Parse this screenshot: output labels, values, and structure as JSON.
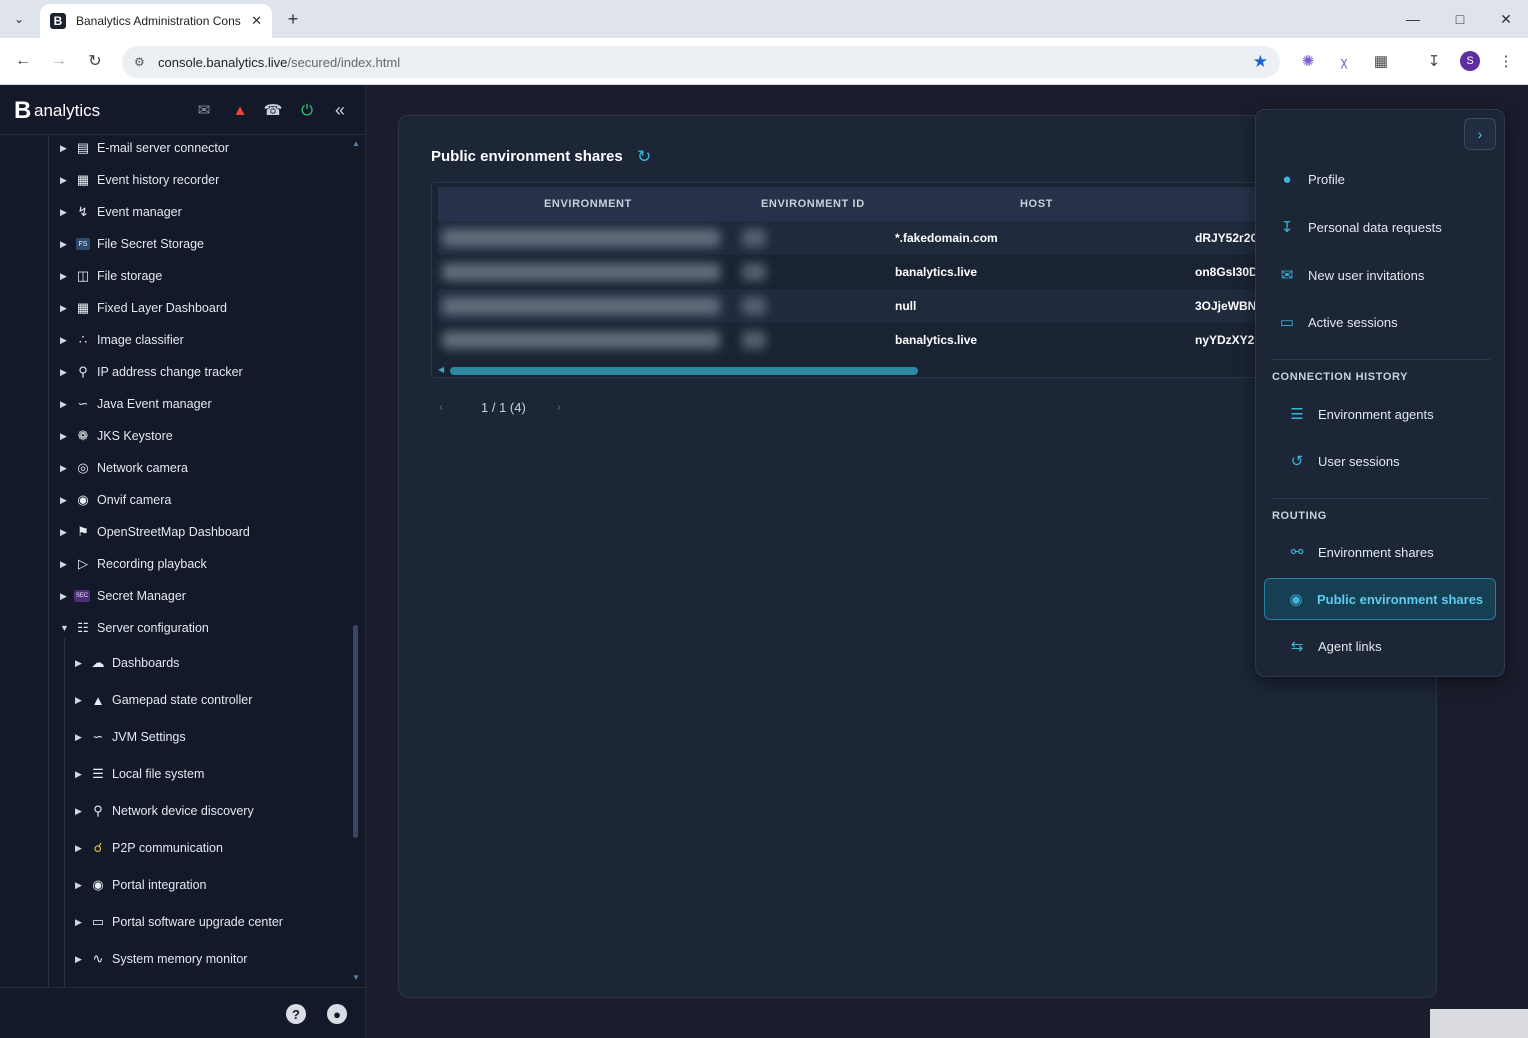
{
  "browser": {
    "tab_title": "Banalytics Administration Cons",
    "url_host": "console.banalytics.live",
    "url_path": "/secured/index.html",
    "profile_initial": "S"
  },
  "app": {
    "logo_mark": "B",
    "logo_text": "analytics",
    "header_icons": [
      {
        "name": "mail-icon",
        "color": "#8a93a3"
      },
      {
        "name": "bell-icon",
        "color": "#e8443a"
      },
      {
        "name": "phone-icon",
        "color": "#c9d1dc"
      },
      {
        "name": "plug-icon",
        "color": "#3fcf76"
      },
      {
        "name": "collapse-double-chevron-icon",
        "color": "#c9d1dc"
      }
    ]
  },
  "tree": {
    "items": [
      {
        "label": "E-mail server connector",
        "icon": "email-server-icon",
        "expanded": false
      },
      {
        "label": "Event history recorder",
        "icon": "event-history-icon",
        "expanded": false
      },
      {
        "label": "Event manager",
        "icon": "event-manager-icon",
        "expanded": false
      },
      {
        "label": "File Secret Storage",
        "icon": "fs-badge-icon",
        "expanded": false
      },
      {
        "label": "File storage",
        "icon": "file-storage-icon",
        "expanded": false
      },
      {
        "label": "Fixed Layer Dashboard",
        "icon": "grid-icon",
        "expanded": false
      },
      {
        "label": "Image classifier",
        "icon": "image-classifier-icon",
        "expanded": false
      },
      {
        "label": "IP address change tracker",
        "icon": "magnifier-icon",
        "expanded": false
      },
      {
        "label": "Java Event manager",
        "icon": "java-icon",
        "expanded": false
      },
      {
        "label": "JKS Keystore",
        "icon": "keystore-icon",
        "expanded": false
      },
      {
        "label": "Network camera",
        "icon": "network-camera-icon",
        "expanded": false
      },
      {
        "label": "Onvif camera",
        "icon": "onvif-camera-icon",
        "expanded": false
      },
      {
        "label": "OpenStreetMap Dashboard",
        "icon": "map-icon",
        "expanded": false
      },
      {
        "label": "Recording playback",
        "icon": "playback-icon",
        "expanded": false
      },
      {
        "label": "Secret Manager",
        "icon": "sec-badge-icon",
        "expanded": false
      },
      {
        "label": "Server configuration",
        "icon": "server-config-icon",
        "expanded": true
      }
    ],
    "children": [
      {
        "label": "Dashboards",
        "icon": "cloud-icon"
      },
      {
        "label": "Gamepad state controller",
        "icon": "gamepad-icon"
      },
      {
        "label": "JVM Settings",
        "icon": "java-icon"
      },
      {
        "label": "Local file system",
        "icon": "database-icon"
      },
      {
        "label": "Network device discovery",
        "icon": "discovery-icon"
      },
      {
        "label": "P2P communication",
        "icon": "p2p-icon"
      },
      {
        "label": "Portal integration",
        "icon": "globe-icon"
      },
      {
        "label": "Portal software upgrade center",
        "icon": "upgrade-icon"
      },
      {
        "label": "System memory monitor",
        "icon": "memory-monitor-icon"
      }
    ]
  },
  "main": {
    "title": "Public environment shares",
    "columns": [
      "ENVIRONMENT",
      "ENVIRONMENT ID",
      "HOST"
    ],
    "rows": [
      {
        "host": "*.fakedomain.com",
        "extra": "dRJY52r2C"
      },
      {
        "host": "banalytics.live",
        "extra": "on8GsI30D"
      },
      {
        "host": "null",
        "extra": "3OJjeWBN"
      },
      {
        "host": "banalytics.live",
        "extra": "nyYDzXY2."
      }
    ],
    "pager": {
      "text": "1 / 1 (4)"
    }
  },
  "menu": {
    "items": [
      {
        "label": "Profile",
        "icon": "user-circle-icon"
      },
      {
        "label": "Personal data requests",
        "icon": "download-icon"
      },
      {
        "label": "New user invitations",
        "icon": "envelope-icon"
      },
      {
        "label": "Active sessions",
        "icon": "monitor-icon"
      }
    ],
    "sections": [
      {
        "title": "CONNECTION HISTORY",
        "items": [
          {
            "label": "Environment agents",
            "icon": "server-icon"
          },
          {
            "label": "User sessions",
            "icon": "history-icon"
          }
        ]
      },
      {
        "title": "ROUTING",
        "items": [
          {
            "label": "Environment shares",
            "icon": "share-icon"
          },
          {
            "label": "Public environment shares",
            "icon": "globe-icon",
            "active": true
          },
          {
            "label": "Agent links",
            "icon": "swap-arrows-icon"
          }
        ]
      }
    ]
  }
}
